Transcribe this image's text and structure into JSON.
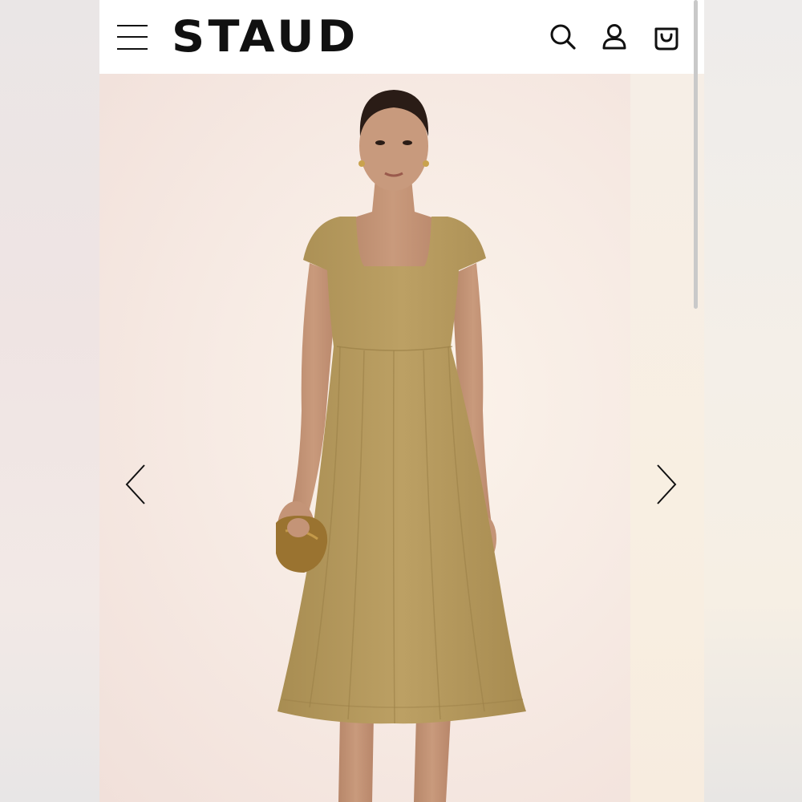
{
  "header": {
    "brand": "STAUD",
    "icons": [
      "menu-icon",
      "search-icon",
      "account-icon",
      "shopping-bag-icon"
    ]
  },
  "carousel": {
    "prev_icon": "chevron-left-icon",
    "next_icon": "chevron-right-icon"
  },
  "product_image": {
    "dress_color": "#b59a5d",
    "clutch_color": "#9a7330",
    "background_color": "#f7ebe4"
  }
}
